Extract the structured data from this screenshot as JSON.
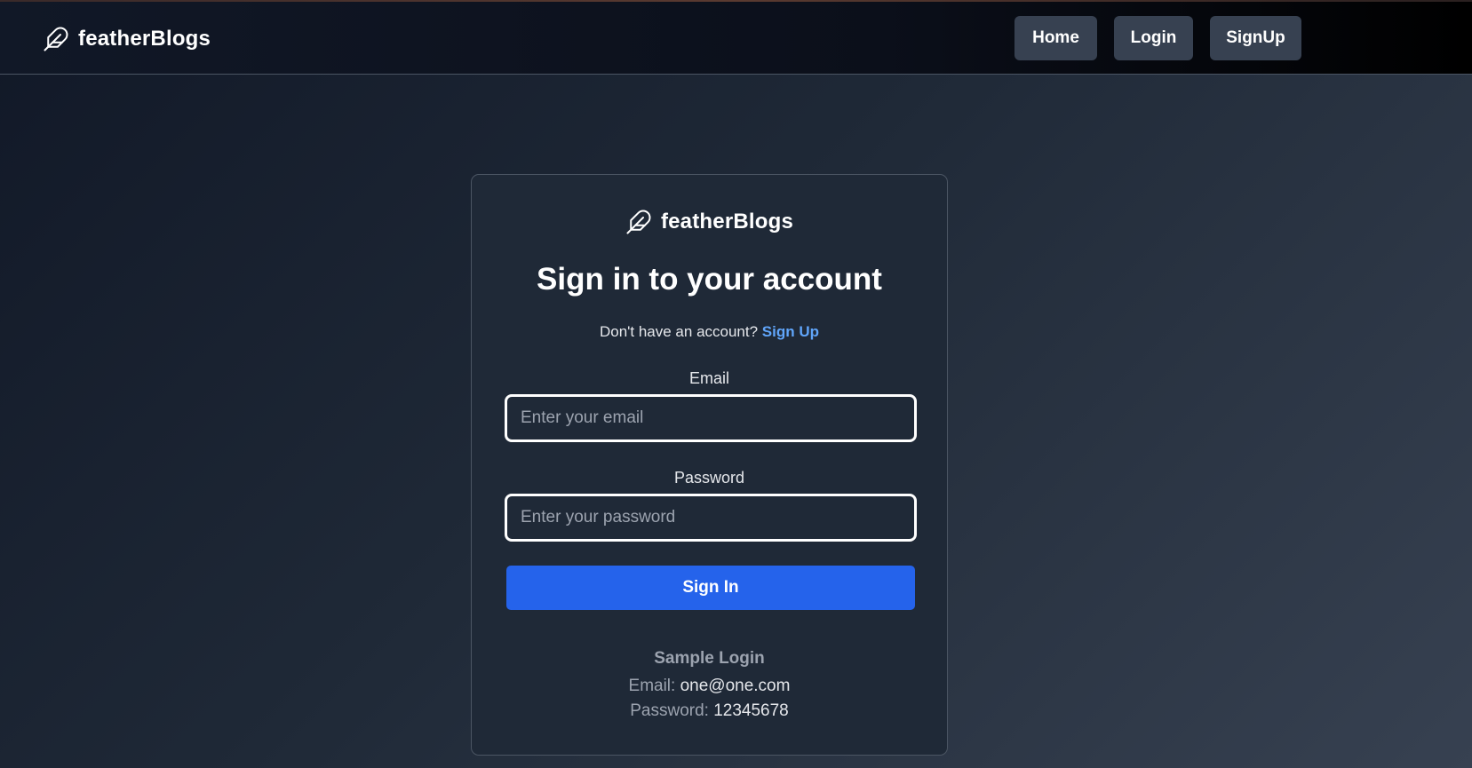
{
  "navbar": {
    "brand_name": "featherBlogs",
    "buttons": {
      "home": "Home",
      "login": "Login",
      "signup": "SignUp"
    }
  },
  "card": {
    "brand_name": "featherBlogs",
    "title": "Sign in to your account",
    "subtitle_text": "Don't have an account?",
    "subtitle_link": "Sign Up",
    "email": {
      "label": "Email",
      "placeholder": "Enter your email",
      "value": ""
    },
    "password": {
      "label": "Password",
      "placeholder": "Enter your password",
      "value": ""
    },
    "submit_label": "Sign In",
    "sample": {
      "title": "Sample Login",
      "email_label": "Email:",
      "email_value": "one@one.com",
      "password_label": "Password:",
      "password_value": "12345678"
    }
  },
  "icons": {
    "brand": "feather-icon"
  },
  "colors": {
    "primary_button": "#2563eb",
    "link": "#60a5fa",
    "nav_button": "#374151",
    "card_bg": "#1f2937"
  }
}
